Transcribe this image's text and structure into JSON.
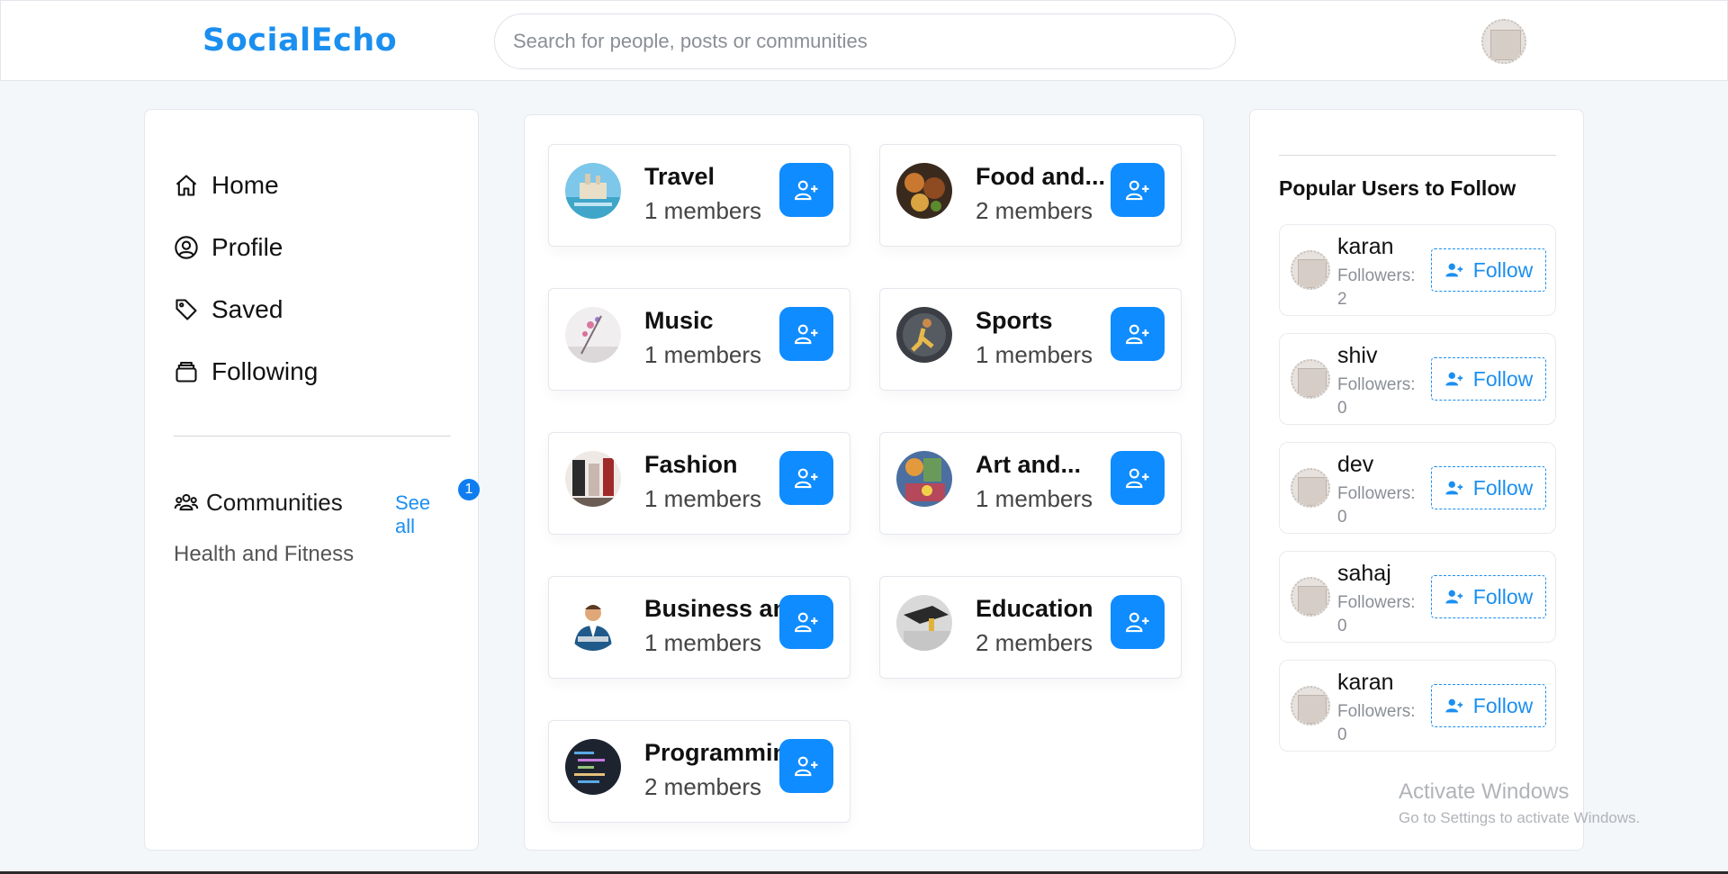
{
  "header": {
    "logo": "SocialEcho",
    "search_placeholder": "Search for people, posts or communities"
  },
  "sidebar": {
    "nav": [
      {
        "label": "Home",
        "icon": "home-icon"
      },
      {
        "label": "Profile",
        "icon": "user-circle-icon"
      },
      {
        "label": "Saved",
        "icon": "tag-icon"
      },
      {
        "label": "Following",
        "icon": "folder-stack-icon"
      }
    ],
    "communities_label": "Communities",
    "see_all_label": "See all",
    "badge_count": "1",
    "joined": [
      "Health and Fitness"
    ]
  },
  "communities": [
    {
      "name": "Travel",
      "members": "1 members",
      "image": "travel-image"
    },
    {
      "name": "Food and...",
      "members": "2 members",
      "image": "food-image"
    },
    {
      "name": "Music",
      "members": "1 members",
      "image": "music-image"
    },
    {
      "name": "Sports",
      "members": "1 members",
      "image": "sports-image"
    },
    {
      "name": "Fashion",
      "members": "1 members",
      "image": "fashion-image"
    },
    {
      "name": "Art and...",
      "members": "1 members",
      "image": "art-image"
    },
    {
      "name": "Business and",
      "members": "1 members",
      "image": "business-image"
    },
    {
      "name": "Education",
      "members": "2 members",
      "image": "education-image"
    },
    {
      "name": "Programming",
      "members": "2 members",
      "image": "programming-image"
    }
  ],
  "popular": {
    "title": "Popular Users to Follow",
    "follow_label": "Follow",
    "followers_label": "Followers:",
    "users": [
      {
        "name": "karan",
        "followers": "2"
      },
      {
        "name": "shiv",
        "followers": "0"
      },
      {
        "name": "dev",
        "followers": "0"
      },
      {
        "name": "sahaj",
        "followers": "0"
      },
      {
        "name": "karan",
        "followers": "0"
      }
    ]
  },
  "watermark": {
    "title": "Activate Windows",
    "subtitle": "Go to Settings to activate Windows."
  },
  "colors": {
    "accent": "#1b8ff0",
    "button": "#0f8cff",
    "background": "#f4f7fa"
  }
}
